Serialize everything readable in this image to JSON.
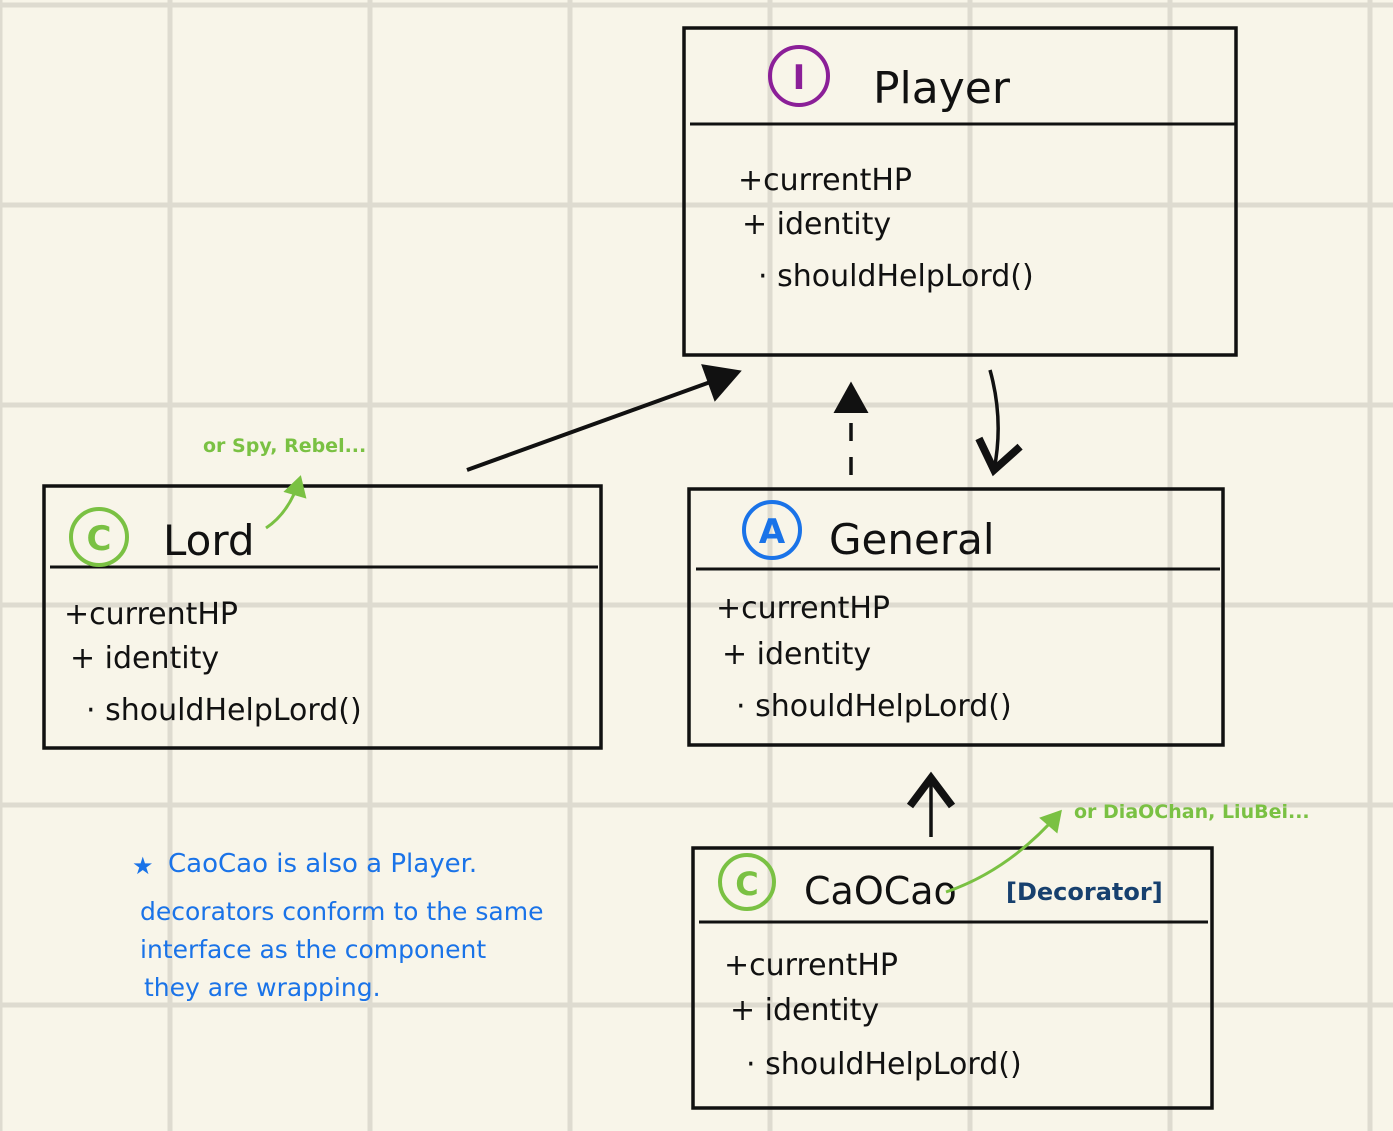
{
  "colors": {
    "background": "#f8f5e9",
    "grid": "#dedbd0",
    "ink": "#111111",
    "interface_badge": "#8b1f98",
    "class_badge": "#7ac143",
    "abstract_badge": "#1a73e8",
    "note": "#1a73e8",
    "decorator_tag": "#17406e",
    "annotation": "#7ac143"
  },
  "classes": {
    "player": {
      "badge": "I",
      "name": "Player",
      "attrs": [
        "+currentHP",
        "+ identity",
        "· shouldHelpLord()"
      ]
    },
    "lord": {
      "badge": "C",
      "name": "Lord",
      "attrs": [
        "+currentHP",
        "+ identity",
        "· shouldHelpLord()"
      ]
    },
    "general": {
      "badge": "A",
      "name": "General",
      "attrs": [
        "+currentHP",
        "+ identity",
        "· shouldHelpLord()"
      ]
    },
    "caocao": {
      "badge": "C",
      "name": "CaOCao",
      "tag": "[Decorator]",
      "attrs": [
        "+currentHP",
        "+ identity",
        "· shouldHelpLord()"
      ]
    }
  },
  "annotations": {
    "lord_alt": "or Spy, Rebel...",
    "caocao_alt": "or DiaOChan, LiuBei..."
  },
  "note": {
    "star": "★",
    "lines": [
      "CaoCao is also a Player.",
      "decorators conform to the same",
      "interface as the component",
      "they are wrapping."
    ]
  }
}
